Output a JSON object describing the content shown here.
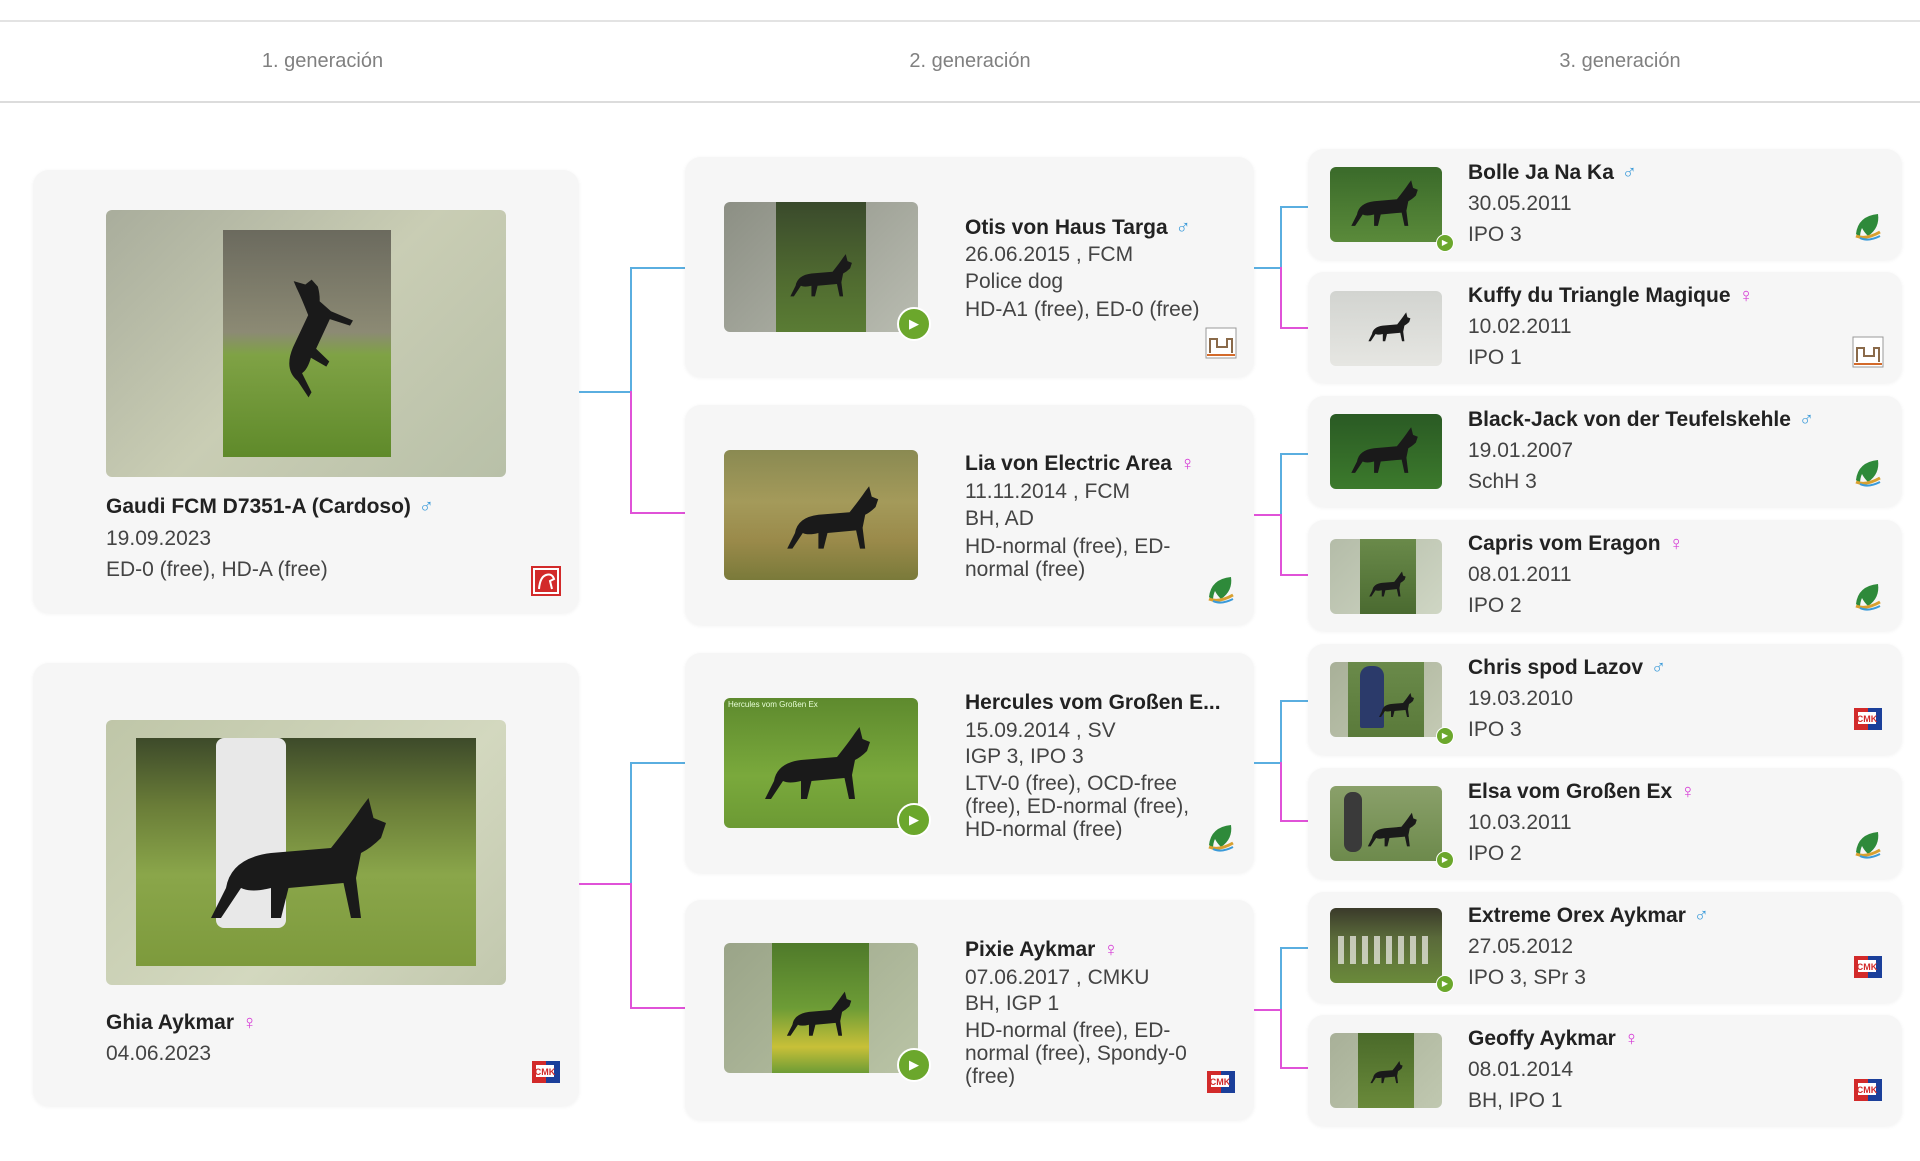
{
  "generations": [
    "1. generación",
    "2. generación",
    "3. generación"
  ],
  "gen1": [
    {
      "name": "Gaudi FCM D7351-A (Cardoso)",
      "sex": "♂",
      "date": "19.09.2023",
      "health": "ED-0 (free), HD-A (free)",
      "logo": "club-logo-red"
    },
    {
      "name": "Ghia Aykmar",
      "sex": "♀",
      "date": "04.06.2023",
      "logo": "cmku-logo"
    }
  ],
  "gen2": [
    {
      "name": "Otis von Haus Targa",
      "sex": "♂",
      "date": "26.06.2015 , FCM",
      "titles": "Police dog",
      "health": "HD-A1 (free), ED-0 (free)",
      "logo": "kennel-logo"
    },
    {
      "name": "Lia von Electric Area",
      "sex": "♀",
      "date": "11.11.2014 , FCM",
      "titles": "BH, AD",
      "health": "HD-normal (free), ED-normal (free)",
      "logo": "leaf-logo"
    },
    {
      "name": "Hercules vom Großen E...",
      "sex": "",
      "date": "15.09.2014 , SV",
      "titles": "IGP 3, IPO 3",
      "health": "LTV-0 (free), OCD-free (free), ED-normal (free), HD-normal (free)",
      "logo": "leaf-logo",
      "photo_caption": "Hercules vom Großen Ex"
    },
    {
      "name": "Pixie Aykmar",
      "sex": "♀",
      "date": "07.06.2017 , CMKU",
      "titles": "BH, IGP 1",
      "health": "HD-normal (free), ED-normal (free), Spondy-0 (free)",
      "logo": "cmku-logo"
    }
  ],
  "gen3": [
    {
      "name": "Bolle Ja Na Ka",
      "sex": "♂",
      "date": "30.05.2011",
      "titles": "IPO 3",
      "logo": "leaf-logo"
    },
    {
      "name": "Kuffy du Triangle Magique",
      "sex": "♀",
      "date": "10.02.2011",
      "titles": "IPO 1",
      "logo": "kennel-logo"
    },
    {
      "name": "Black-Jack von der Teufelskehle",
      "sex": "♂",
      "date": "19.01.2007",
      "titles": "SchH 3",
      "logo": "leaf-logo"
    },
    {
      "name": "Capris vom Eragon",
      "sex": "♀",
      "date": "08.01.2011",
      "titles": "IPO 2",
      "logo": "leaf-logo"
    },
    {
      "name": "Chris spod Lazov",
      "sex": "♂",
      "date": "19.03.2010",
      "titles": "IPO 3",
      "logo": "cmku-logo"
    },
    {
      "name": "Elsa vom Großen Ex",
      "sex": "♀",
      "date": "10.03.2011",
      "titles": "IPO 2",
      "logo": "leaf-logo"
    },
    {
      "name": "Extreme Orex Aykmar",
      "sex": "♂",
      "date": "27.05.2012",
      "titles": "IPO 3, SPr 3",
      "logo": "cmku-logo"
    },
    {
      "name": "Geoffy Aykmar",
      "sex": "♀",
      "date": "08.01.2014",
      "titles": "BH, IPO 1",
      "logo": "cmku-logo"
    }
  ],
  "colors": {
    "male": "#3a9ad9",
    "female": "#d63bd6",
    "play": "#6ba72c",
    "card": "#f6f6f6"
  }
}
